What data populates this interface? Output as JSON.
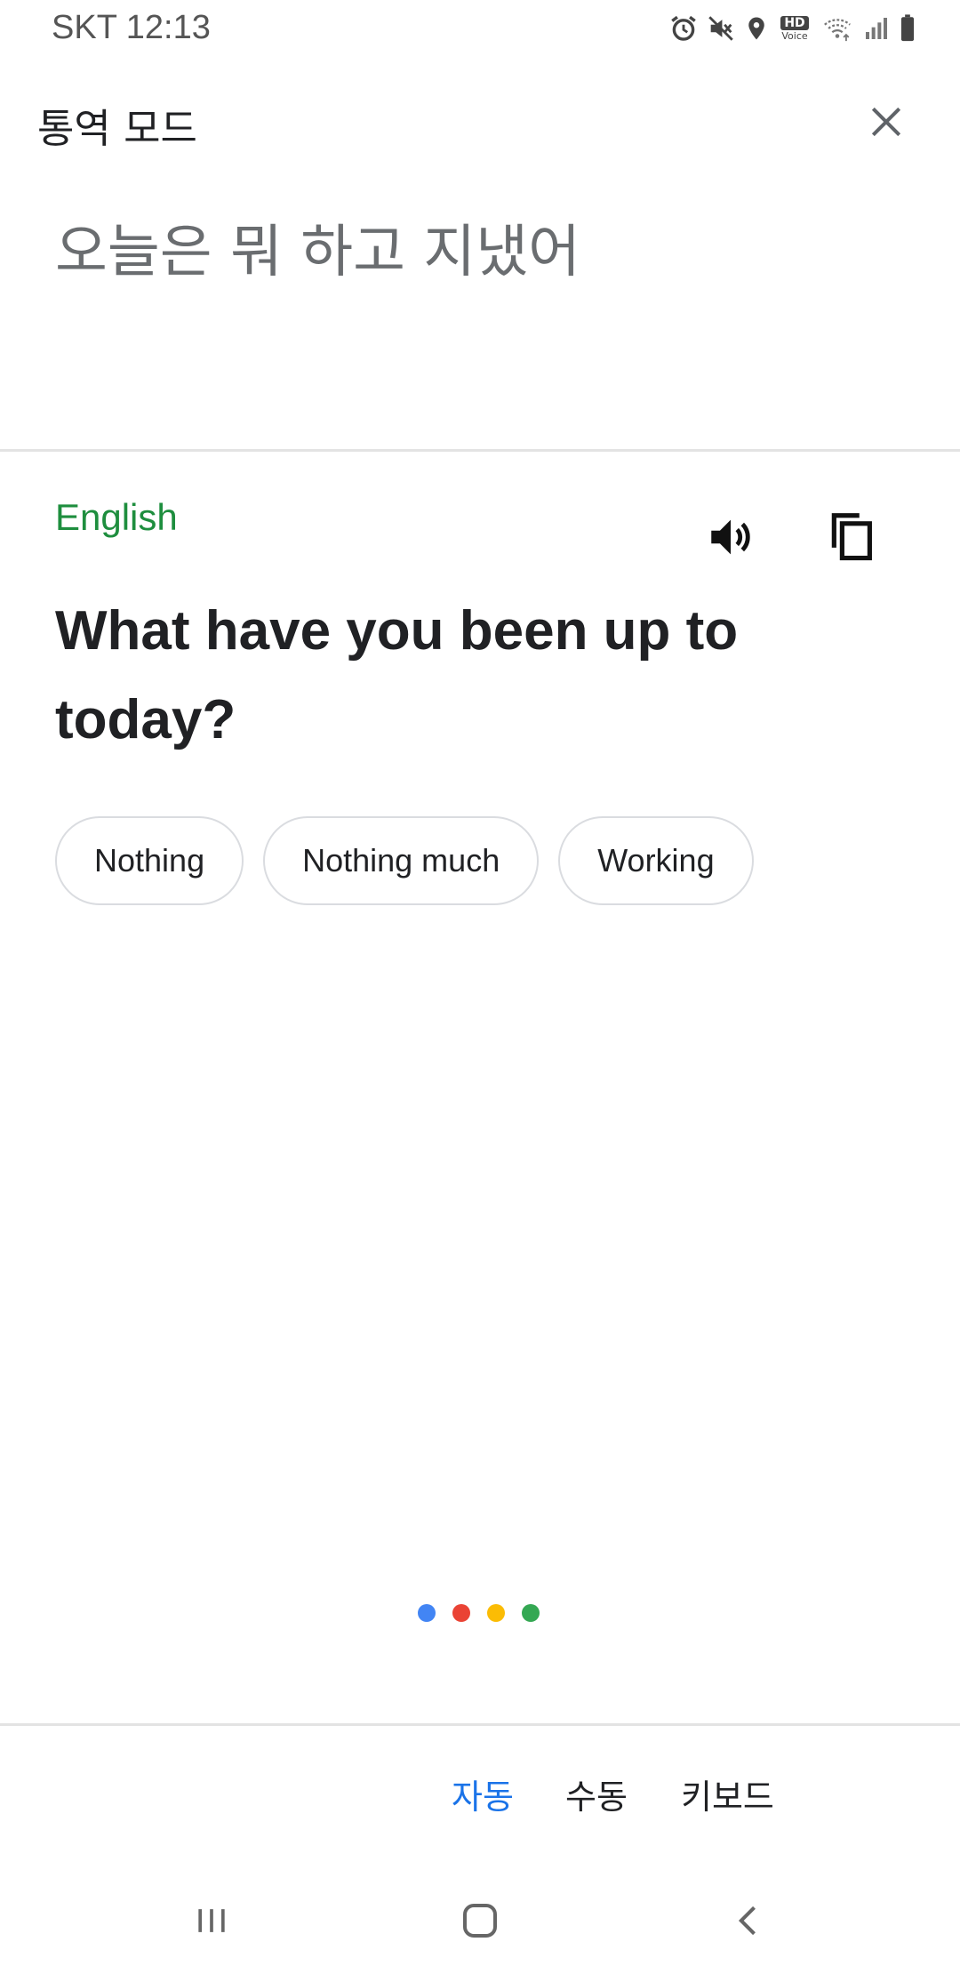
{
  "status_bar": {
    "time": "SKT 12:13",
    "icons": [
      "alarm-icon",
      "mute-icon",
      "location-icon",
      "hd-voice-icon",
      "wifi-icon",
      "signal-icon",
      "battery-icon"
    ],
    "hd_voice_label": "HD",
    "hd_voice_sub": "Voice"
  },
  "header": {
    "title": "통역 모드",
    "close_icon": "close-icon"
  },
  "source": {
    "text": "오늘은 뭐 하고 지냈어"
  },
  "translation": {
    "language": "English",
    "text": "What have you been up to today?",
    "speaker_icon": "speaker-icon",
    "copy_icon": "copy-icon"
  },
  "suggestions": [
    "Nothing",
    "Nothing much",
    "Working"
  ],
  "listening_dots": [
    "#4285f4",
    "#ea4335",
    "#fbbc04",
    "#34a853"
  ],
  "mode_tabs": {
    "auto": "자동",
    "manual": "수동",
    "keyboard": "키보드",
    "active": "auto"
  },
  "colors": {
    "accent": "#1a73e8",
    "language": "#1e8e3e"
  }
}
